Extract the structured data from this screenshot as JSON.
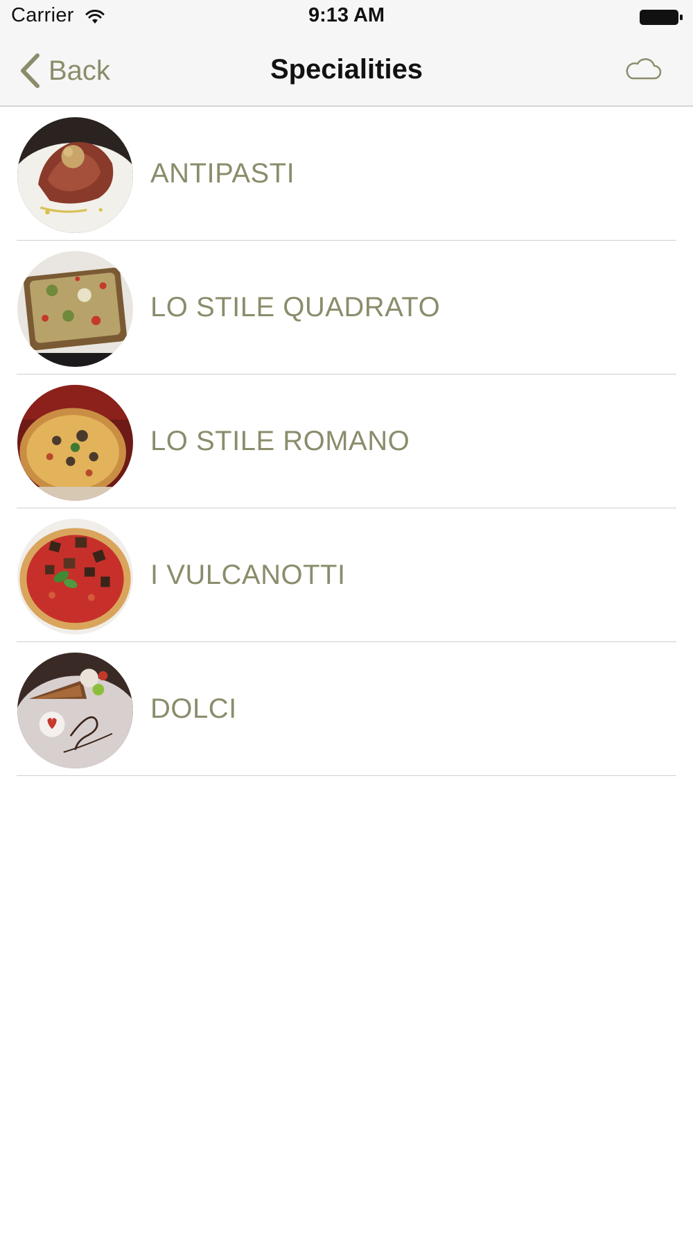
{
  "status_bar": {
    "carrier": "Carrier",
    "time": "9:13 AM",
    "wifi_icon": "wifi-icon",
    "battery_icon": "battery-full-icon"
  },
  "nav": {
    "back_label": "Back",
    "back_icon": "chevron-left-icon",
    "title": "Specialities",
    "right_icon": "cloud-icon"
  },
  "colors": {
    "accent": "#8b8c6b",
    "nav_background": "#f6f6f6",
    "separator": "#cfcfcf"
  },
  "categories": [
    {
      "label": "ANTIPASTI",
      "icon": "antipasti-photo"
    },
    {
      "label": "LO STILE QUADRATO",
      "icon": "square-pizza-photo"
    },
    {
      "label": "LO STILE ROMANO",
      "icon": "roman-pizza-photo"
    },
    {
      "label": "I VULCANOTTI",
      "icon": "vulcanotti-pizza-photo"
    },
    {
      "label": "DOLCI",
      "icon": "dessert-photo"
    }
  ]
}
